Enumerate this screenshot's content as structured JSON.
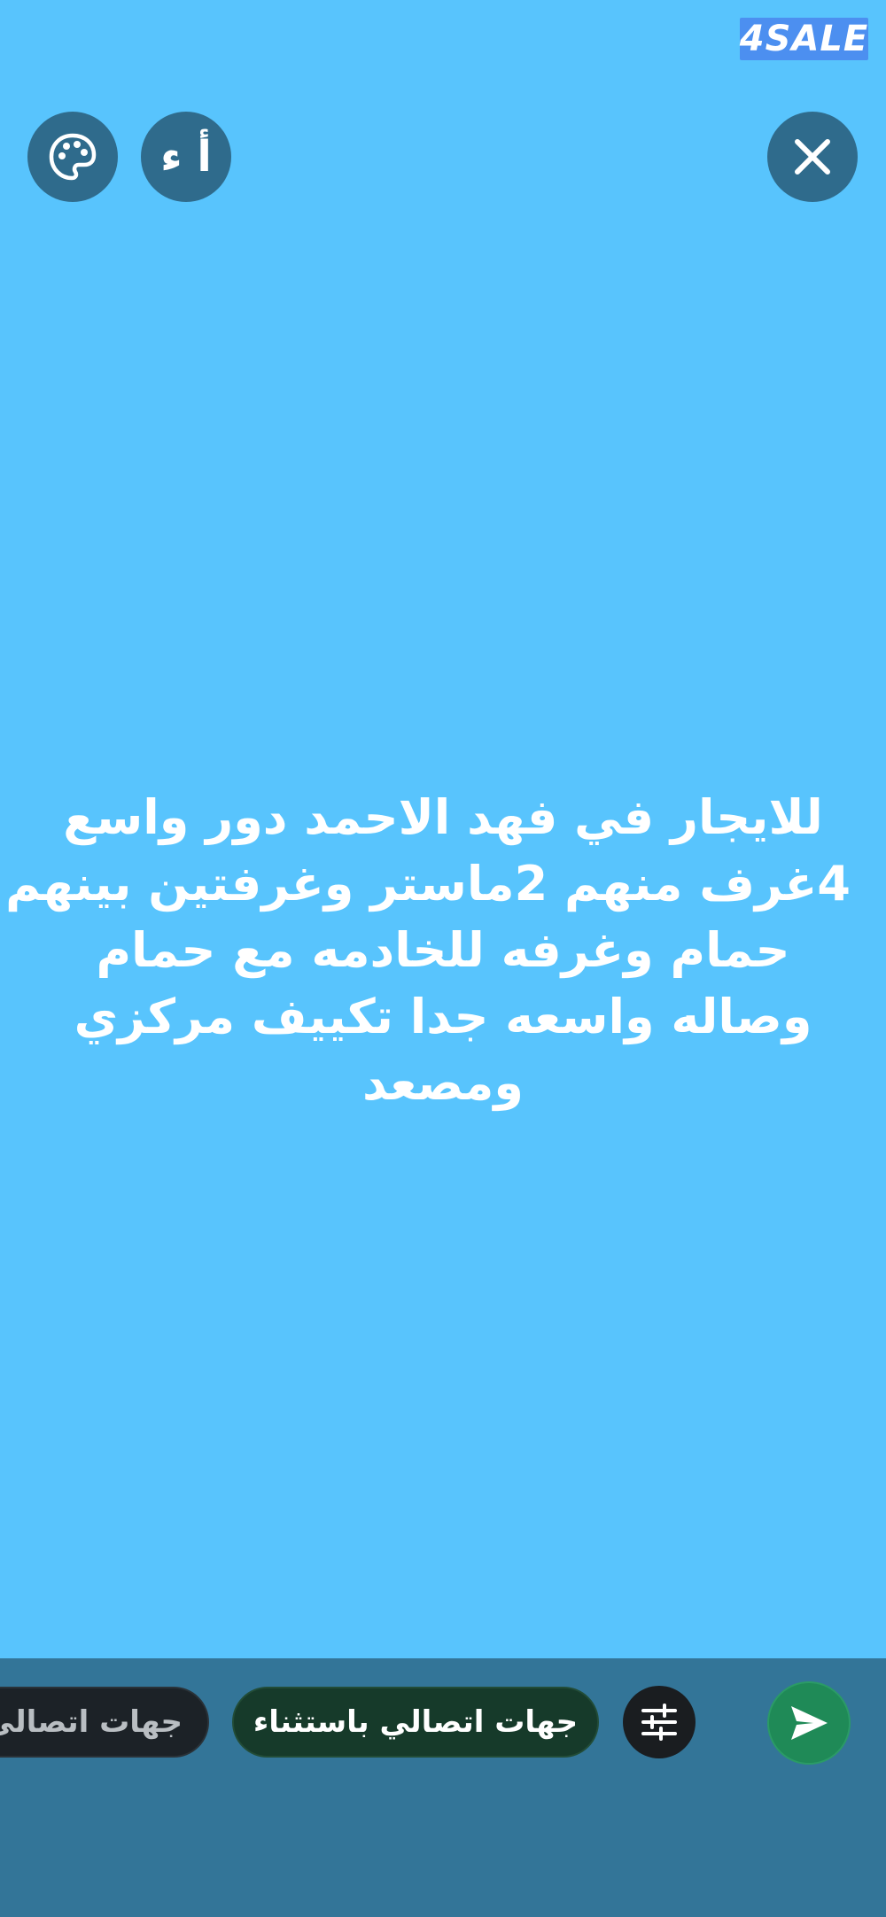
{
  "watermark": {
    "text": "4SALE"
  },
  "toolbar": {
    "font_label": "أ ء",
    "close_icon": "close-icon",
    "palette_icon": "palette-icon"
  },
  "post": {
    "lines": [
      "للايجار في فهد الاحمد دور واسع",
      "4غرف منهم 2ماستر وغرفتين بينهم",
      "حمام وغرفه للخادمه مع حمام",
      "وصاله واسعه جدا تكييف مركزي",
      "ومصعد"
    ]
  },
  "bottom": {
    "privacy_options": [
      {
        "label": "جهات اتصالي باستثناء",
        "selected": true
      },
      {
        "label": "جهات اتصالي",
        "selected": false
      }
    ],
    "filter_icon": "sliders-icon",
    "send_icon": "send-icon"
  },
  "colors": {
    "background": "#58c4fd",
    "bottom_bar": "#337598",
    "button": "#2f6b8c",
    "send": "#1f8a57"
  }
}
